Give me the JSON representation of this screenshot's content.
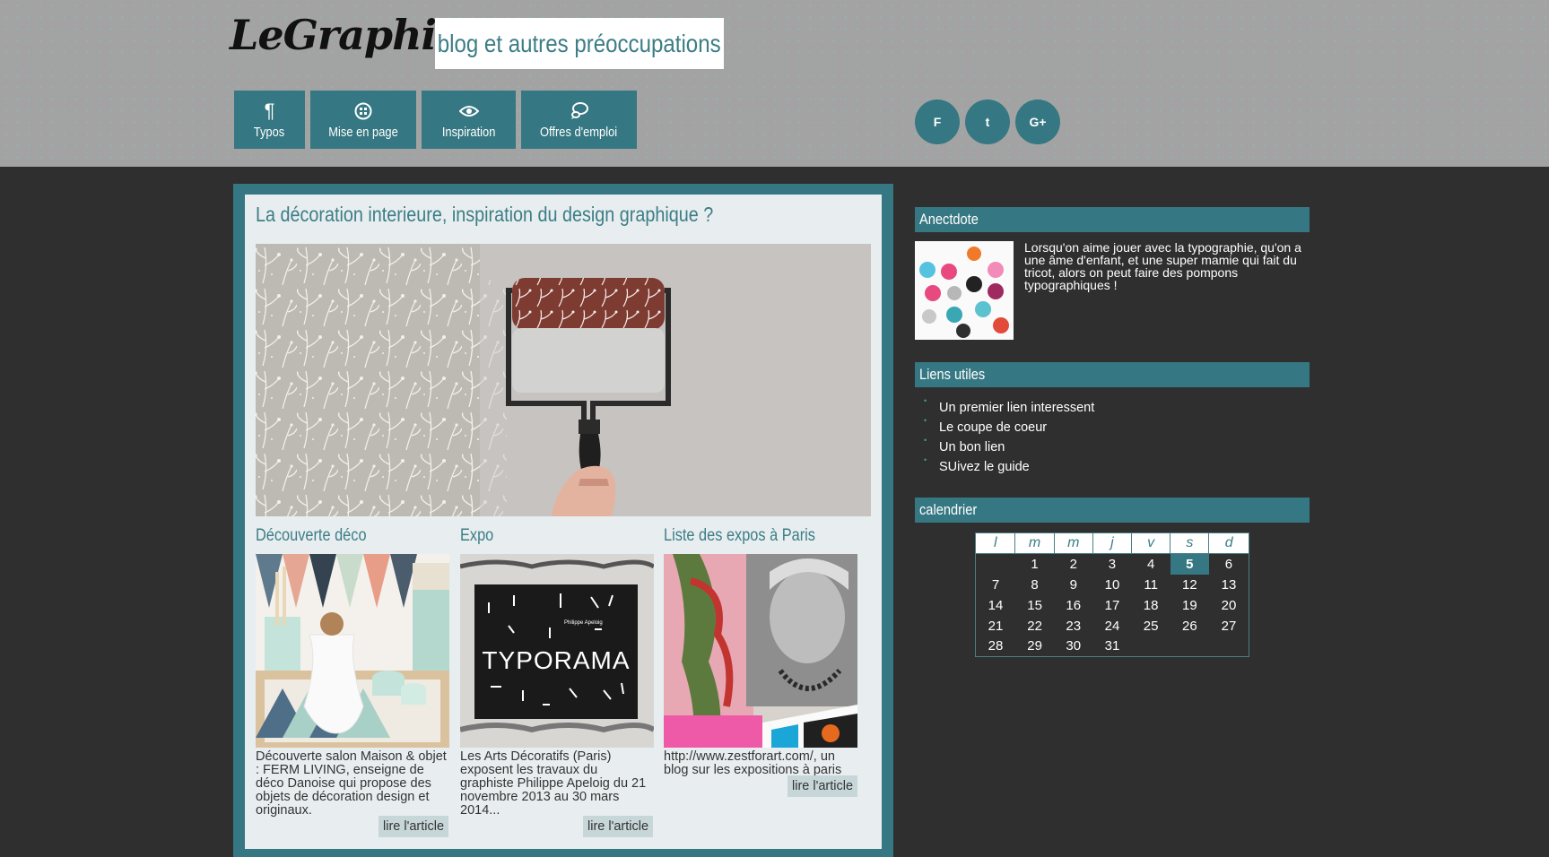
{
  "header": {
    "logo": "LeGraphiste,",
    "tagline": "blog et autres préoccupations",
    "nav": [
      {
        "label": "Typos",
        "icon": "pilcrow-icon"
      },
      {
        "label": "Mise en page",
        "icon": "layout-grid-icon"
      },
      {
        "label": "Inspiration",
        "icon": "eye-icon"
      },
      {
        "label": "Offres d'emploi",
        "icon": "chat-bubble-icon"
      }
    ],
    "social": [
      {
        "label": "F",
        "icon": "facebook-icon"
      },
      {
        "label": "t",
        "icon": "twitter-icon"
      },
      {
        "label": "G+",
        "icon": "googleplus-icon"
      }
    ]
  },
  "article": {
    "title": "La décoration interieure, inspiration du design graphique ?",
    "columns": [
      {
        "title": "Découverte déco",
        "text": "Découverte salon Maison & objet : FERM LIVING, enseigne de déco Danoise qui propose des objets de décoration design et originaux.",
        "button": "lire l'article"
      },
      {
        "title": "Expo",
        "text": "Les Arts Décoratifs (Paris) exposent les travaux du graphiste Philippe Apeloig du 21 novembre 2013 au 30 mars 2014...",
        "button": "lire l'article",
        "image_caption_small": "Philippe Apeloig",
        "image_caption_big": "TYPORAMA"
      },
      {
        "title": "Liste des expos à Paris",
        "text": "http://www.zestforart.com/, un blog sur les expositions à paris",
        "button": "lire l'article"
      }
    ]
  },
  "sidebar": {
    "anecdote_title": "Anectdote",
    "anecdote_text": "Lorsqu'on aime jouer avec la typographie, qu'on a une âme d'enfant, et une super mamie qui fait du tricot, alors on peut faire des pompons typographiques !",
    "links_title": "Liens utiles",
    "links": [
      "Un premier lien interessent",
      "Le coupe de coeur",
      "Un bon lien",
      "SUivez le guide"
    ],
    "calendar_title": "calendrier",
    "calendar_days": [
      "l",
      "m",
      "m",
      "j",
      "v",
      "s",
      "d"
    ],
    "calendar_weeks": [
      [
        "",
        "1",
        "2",
        "3",
        "4",
        "5",
        "6"
      ],
      [
        "7",
        "8",
        "9",
        "10",
        "11",
        "12",
        "13"
      ],
      [
        "14",
        "15",
        "16",
        "17",
        "18",
        "19",
        "20"
      ],
      [
        "21",
        "22",
        "23",
        "24",
        "25",
        "26",
        "27"
      ],
      [
        "28",
        "29",
        "30",
        "31",
        "",
        "",
        ""
      ]
    ],
    "calendar_today": "5"
  },
  "colors": {
    "accent": "#357782",
    "accent_text": "#3c7d86",
    "background": "#2f2f2f",
    "header_bg": "#a3a3a3"
  }
}
